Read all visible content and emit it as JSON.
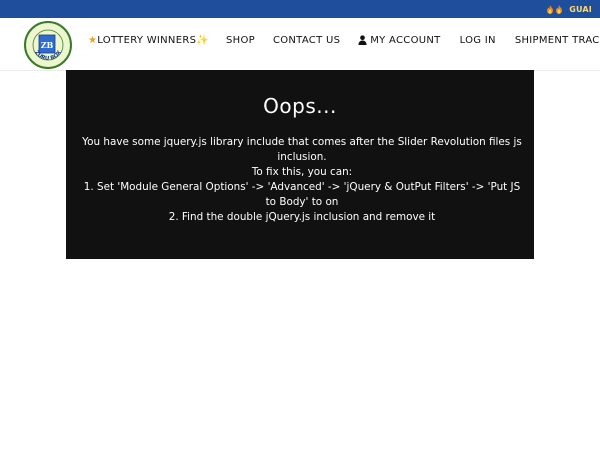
{
  "topbar": {
    "icons": [
      "flame-icon",
      "flame-icon"
    ],
    "text": "GUAI",
    "background": "#1f4f9c"
  },
  "logo": {
    "text_top": "ZB",
    "text_ring": "ZURU BOX"
  },
  "nav": {
    "items": [
      {
        "label": "LOTTERY WINNERS",
        "prefix_icon": "star-icon",
        "suffix_icon": "sparkle-icon"
      },
      {
        "label": "SHOP"
      },
      {
        "label": "CONTACT US"
      },
      {
        "label": "MY ACCOUNT",
        "prefix_icon": "user-icon"
      },
      {
        "label": "LOG IN"
      },
      {
        "label": "SHIPMENT TRACKING"
      }
    ]
  },
  "error_panel": {
    "title": "Oops...",
    "lines": [
      "You have some jquery.js library include that comes after the Slider Revolution files js inclusion.",
      "To fix this, you can:",
      "1. Set 'Module General Options' -> 'Advanced' -> 'jQuery & OutPut Filters' -> 'Put JS to Body' to on",
      "2. Find the double jQuery.js inclusion and remove it"
    ],
    "background": "#111111"
  }
}
